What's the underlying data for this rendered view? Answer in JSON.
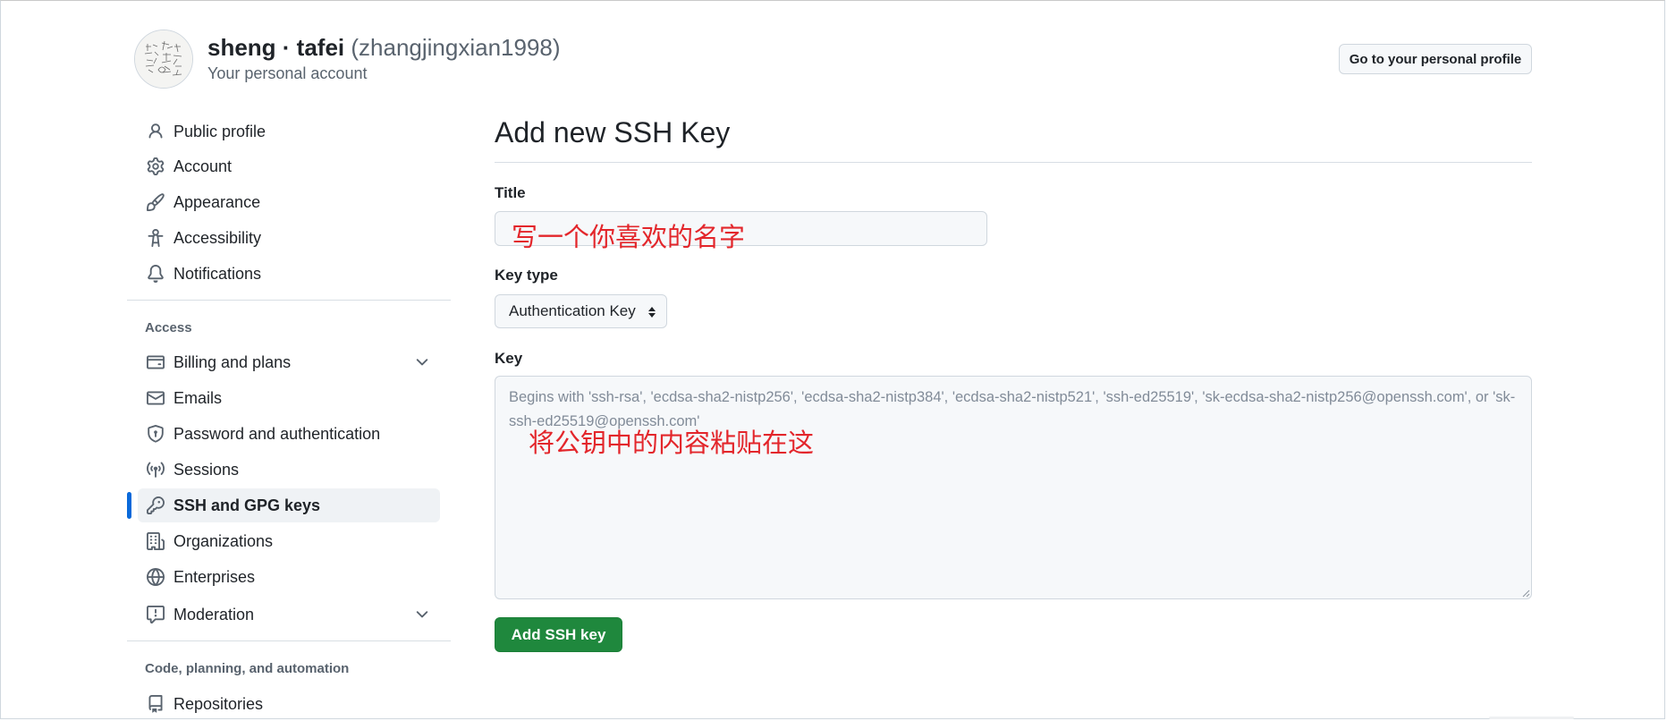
{
  "header": {
    "display_name": "sheng · tafei",
    "username": "(zhangjingxian1998)",
    "subtitle": "Your personal account",
    "profile_button": "Go to your personal profile"
  },
  "sidebar": {
    "top_items": [
      {
        "label": "Public profile",
        "icon": "person-icon"
      },
      {
        "label": "Account",
        "icon": "gear-icon"
      },
      {
        "label": "Appearance",
        "icon": "paintbrush-icon"
      },
      {
        "label": "Accessibility",
        "icon": "accessibility-icon"
      },
      {
        "label": "Notifications",
        "icon": "bell-icon"
      }
    ],
    "access_label": "Access",
    "access_items": [
      {
        "label": "Billing and plans",
        "icon": "credit-card-icon",
        "expandable": true
      },
      {
        "label": "Emails",
        "icon": "mail-icon"
      },
      {
        "label": "Password and authentication",
        "icon": "shield-lock-icon"
      },
      {
        "label": "Sessions",
        "icon": "broadcast-icon"
      },
      {
        "label": "SSH and GPG keys",
        "icon": "key-icon",
        "selected": true
      },
      {
        "label": "Organizations",
        "icon": "organization-icon"
      },
      {
        "label": "Enterprises",
        "icon": "globe-icon"
      },
      {
        "label": "Moderation",
        "icon": "report-icon",
        "expandable": true
      }
    ],
    "code_label": "Code, planning, and automation",
    "code_items": [
      {
        "label": "Repositories",
        "icon": "repo-icon"
      }
    ]
  },
  "main": {
    "title": "Add new SSH Key",
    "title_field": {
      "label": "Title",
      "value": ""
    },
    "key_type": {
      "label": "Key type",
      "selected": "Authentication Key"
    },
    "key_field": {
      "label": "Key",
      "placeholder": "Begins with 'ssh-rsa', 'ecdsa-sha2-nistp256', 'ecdsa-sha2-nistp384', 'ecdsa-sha2-nistp521', 'ssh-ed25519', 'sk-ecdsa-sha2-nistp256@openssh.com', or 'sk-ssh-ed25519@openssh.com'"
    },
    "submit_label": "Add SSH key"
  },
  "annotations": {
    "title_note": "写一个你喜欢的名字",
    "key_note": "将公钥中的内容粘贴在这"
  },
  "colors": {
    "accent_blue": "#0969da",
    "primary_green": "#1f883d",
    "annotation_red": "#e3262b",
    "muted_text": "#59636e"
  }
}
